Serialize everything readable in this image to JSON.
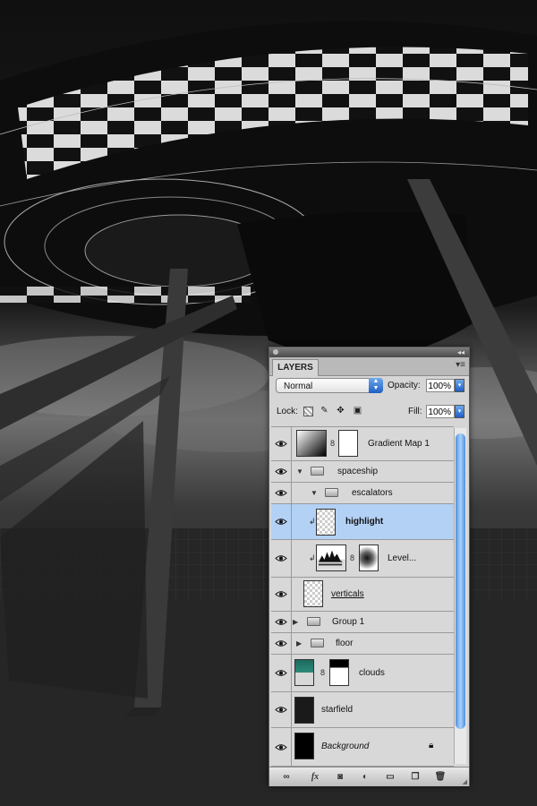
{
  "panel": {
    "tab_label": "LAYERS",
    "blend_mode": "Normal",
    "opacity_label": "Opacity:",
    "opacity_value": "100%",
    "lock_label": "Lock:",
    "fill_label": "Fill:",
    "fill_value": "100%"
  },
  "layers": [
    {
      "name": "Gradient Map 1"
    },
    {
      "name": "spaceship"
    },
    {
      "name": "escalators"
    },
    {
      "name": "highlight"
    },
    {
      "name": "Level..."
    },
    {
      "name": "verticals"
    },
    {
      "name": "Group 1"
    },
    {
      "name": "floor"
    },
    {
      "name": "clouds"
    },
    {
      "name": "starfield"
    },
    {
      "name": "Background"
    }
  ],
  "colors": {
    "selected_row": "#b3d1f5",
    "accent_blue": "#1f5fc4",
    "panel_bg": "#d6d6d6"
  },
  "icons": {
    "eye": "eye-icon",
    "folder": "folder-icon",
    "link": "link-icon",
    "lock": "lock-icon",
    "trash": "trash-icon"
  }
}
